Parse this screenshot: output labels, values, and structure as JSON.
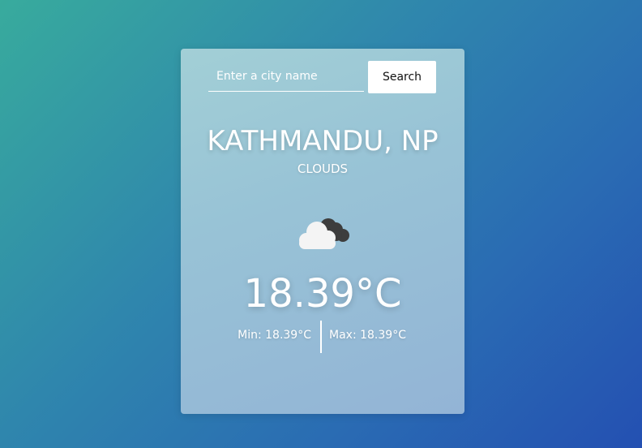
{
  "search": {
    "placeholder": "Enter a city name",
    "value": "",
    "button_label": "Search"
  },
  "weather": {
    "city": "KATHMANDU, NP",
    "condition": "CLOUDS",
    "icon": "cloud-icon",
    "temperature": "18.39°C",
    "min": "Min: 18.39°C",
    "max": "Max: 18.39°C"
  }
}
